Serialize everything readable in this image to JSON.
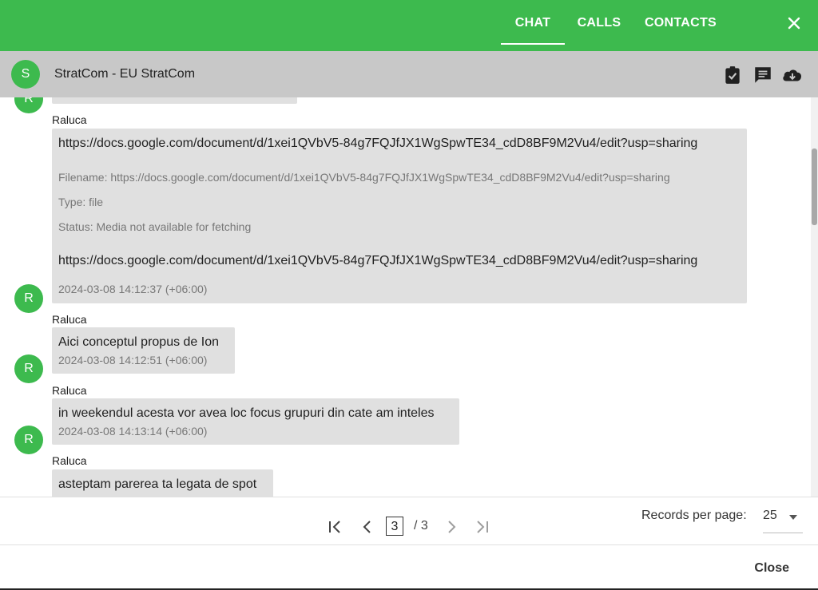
{
  "topbar": {
    "tabs": [
      {
        "label": "CHAT",
        "active": true
      },
      {
        "label": "CALLS",
        "active": false
      },
      {
        "label": "CONTACTS",
        "active": false
      }
    ],
    "accent_color": "#3dba4e"
  },
  "conversation": {
    "avatar_letter": "S",
    "title": "StratCom - EU StratCom",
    "icons": [
      "clipboard-check-icon",
      "comment-icon",
      "cloud-download-icon"
    ]
  },
  "messages": [
    {
      "sender": "",
      "avatar_letter": "R"
    },
    {
      "sender": "Raluca",
      "avatar_letter": "R",
      "text": "https://docs.google.com/document/d/1xei1QVbV5-84g7FQJfJX1WgSpwTE34_cdD8BF9M2Vu4/edit?usp=sharing",
      "filename": "Filename: https://docs.google.com/document/d/1xei1QVbV5-84g7FQJfJX1WgSpwTE34_cdD8BF9M2Vu4/edit?usp=sharing",
      "type": "Type: file",
      "status": "Status: Media not available for fetching",
      "text2": "https://docs.google.com/document/d/1xei1QVbV5-84g7FQJfJX1WgSpwTE34_cdD8BF9M2Vu4/edit?usp=sharing",
      "timestamp": "2024-03-08 14:12:37 (+06:00)"
    },
    {
      "sender": "Raluca",
      "avatar_letter": "R",
      "text": "Aici conceptul propus de Ion",
      "timestamp": "2024-03-08 14:12:51 (+06:00)"
    },
    {
      "sender": "Raluca",
      "avatar_letter": "R",
      "text": "in weekendul acesta vor avea loc focus grupuri din cate am inteles",
      "timestamp": "2024-03-08 14:13:14 (+06:00)"
    },
    {
      "sender": "Raluca",
      "avatar_letter": "R",
      "text": "asteptam parerea ta legata de spot"
    }
  ],
  "pagination": {
    "current_page": "3",
    "total": "/ 3",
    "records_label": "Records per page:",
    "records_value": "25"
  },
  "footer": {
    "close_label": "Close"
  }
}
